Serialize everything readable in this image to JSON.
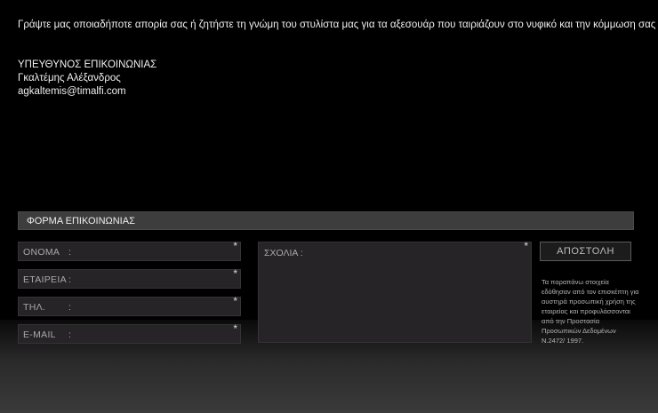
{
  "intro": "Γράψτε μας οποιαδήποτε απορία σας ή ζητήστε τη γνώμη του στυλίστα μας για τα αξεσουάρ που ταιριάζουν στο νυφικό και την κόμμωση σας .",
  "contact": {
    "role": "ΥΠΕΥΘΥΝΟΣ ΕΠΙΚΟΙΝΩΝΙΑΣ",
    "name": "Γκαλτέμης Αλέξανδρος",
    "email": "agkaltemis@timalfi.com"
  },
  "form": {
    "title": "ΦΟΡΜΑ ΕΠΙΚΟΙΝΩΝΙΑΣ",
    "fields": [
      {
        "label": "ΟΝΟΜΑ",
        "colon": ":",
        "required": "*"
      },
      {
        "label": "ΕΤΑΙΡΕΙΑ",
        "colon": ":",
        "required": "*"
      },
      {
        "label": "ΤΗΛ.",
        "colon": ":",
        "required": "*"
      },
      {
        "label": "E-MAIL",
        "colon": ":",
        "required": "*"
      }
    ],
    "comments": {
      "label": "ΣΧΟΛΙΑ :",
      "required": "*"
    },
    "submit_label": "ΑΠΟΣΤΟΛΗ",
    "disclaimer": "Τα παραπάνω στοιχεία εδόθησαν από τον επισκέπτη για αυστηρά προσωπική χρήση της εταιρείας και προφυλάσσονται από την Προστασία Προσωπικών Δεδομένων Ν.2472/ 1997."
  },
  "colors": {
    "background": "#000000",
    "field_bg": "#262426",
    "header_bg": "#3d3d3d"
  }
}
